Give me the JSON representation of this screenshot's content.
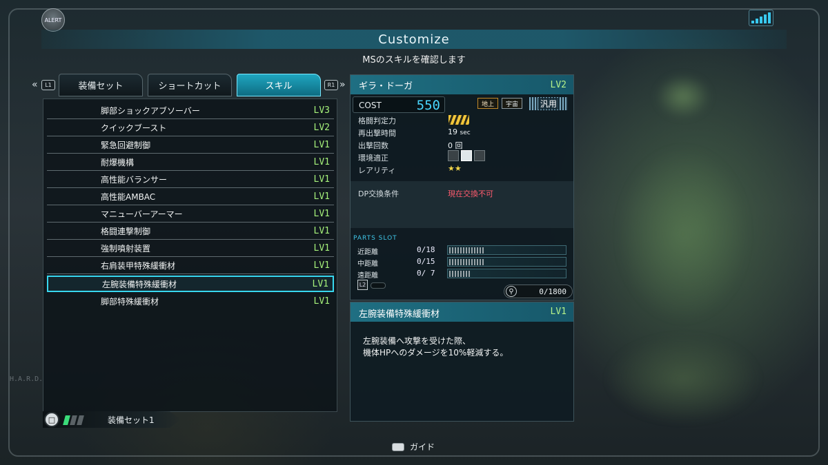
{
  "header": {
    "alert_label": "ALERT",
    "title": "Customize",
    "subtitle": "MSのスキルを確認します",
    "side_text": "H.A.R.D."
  },
  "tabs": {
    "left_button": "L1",
    "right_button": "R1",
    "items": [
      {
        "label": "装備セット",
        "active": false
      },
      {
        "label": "ショートカット",
        "active": false
      },
      {
        "label": "スキル",
        "active": true
      }
    ]
  },
  "skills": [
    {
      "name": "脚部ショックアブソーバー",
      "level": "LV3",
      "selected": false
    },
    {
      "name": "クイックブースト",
      "level": "LV2",
      "selected": false
    },
    {
      "name": "緊急回避制御",
      "level": "LV1",
      "selected": false
    },
    {
      "name": "耐爆機構",
      "level": "LV1",
      "selected": false
    },
    {
      "name": "高性能バランサー",
      "level": "LV1",
      "selected": false
    },
    {
      "name": "高性能AMBAC",
      "level": "LV1",
      "selected": false
    },
    {
      "name": "マニューバーアーマー",
      "level": "LV1",
      "selected": false
    },
    {
      "name": "格闘連撃制御",
      "level": "LV1",
      "selected": false
    },
    {
      "name": "強制噴射装置",
      "level": "LV1",
      "selected": false
    },
    {
      "name": "右肩装甲特殊緩衝材",
      "level": "LV1",
      "selected": false
    },
    {
      "name": "左腕装備特殊緩衝材",
      "level": "LV1",
      "selected": true
    },
    {
      "name": "脚部特殊緩衝材",
      "level": "LV1",
      "selected": false
    }
  ],
  "loadout": {
    "label": "装備セット1",
    "button_glyph": "□",
    "active_bars": 1,
    "total_bars": 3
  },
  "ms_info": {
    "name": "ギラ・ドーガ",
    "level": "LV2",
    "cost_label": "COST",
    "cost_value": "550",
    "env_ground": "地上",
    "env_space": "宇宙",
    "type": "汎用",
    "stats": [
      {
        "label": "格闘判定力",
        "value": "",
        "icon": "melee-rank-icon"
      },
      {
        "label": "再出撃時間",
        "value": "19",
        "unit": "sec"
      },
      {
        "label": "出撃回数",
        "value": "0 回"
      },
      {
        "label": "環境適正",
        "value": "",
        "icon": "terrain-rank-icon"
      },
      {
        "label": "レアリティ",
        "value": "★★"
      }
    ],
    "dp_label": "DP交換条件",
    "dp_value": "現在交換不可",
    "dp_color": "#ff5b6e"
  },
  "parts_slot": {
    "title": "PARTS SLOT",
    "rows": [
      {
        "label": "近距離",
        "value": "0/18",
        "fill": 0.3
      },
      {
        "label": "中距離",
        "value": "0/15",
        "fill": 0.3
      },
      {
        "label": "遠距離",
        "value": "0/ 7",
        "fill": 0.18
      }
    ],
    "l2_button": "L2",
    "gear_value": "0/1800"
  },
  "skill_detail": {
    "name": "左腕装備特殊緩衝材",
    "level": "LV1",
    "description": "左腕装備へ攻撃を受けた際、\n機体HPへのダメージを10%軽減する。"
  },
  "footer": {
    "guide_label": "ガイド"
  },
  "colors": {
    "accent": "#1fa6c0",
    "level_text": "#a5f07a",
    "cost_text": "#49d6ff",
    "selection_outline": "#38d8f0"
  }
}
